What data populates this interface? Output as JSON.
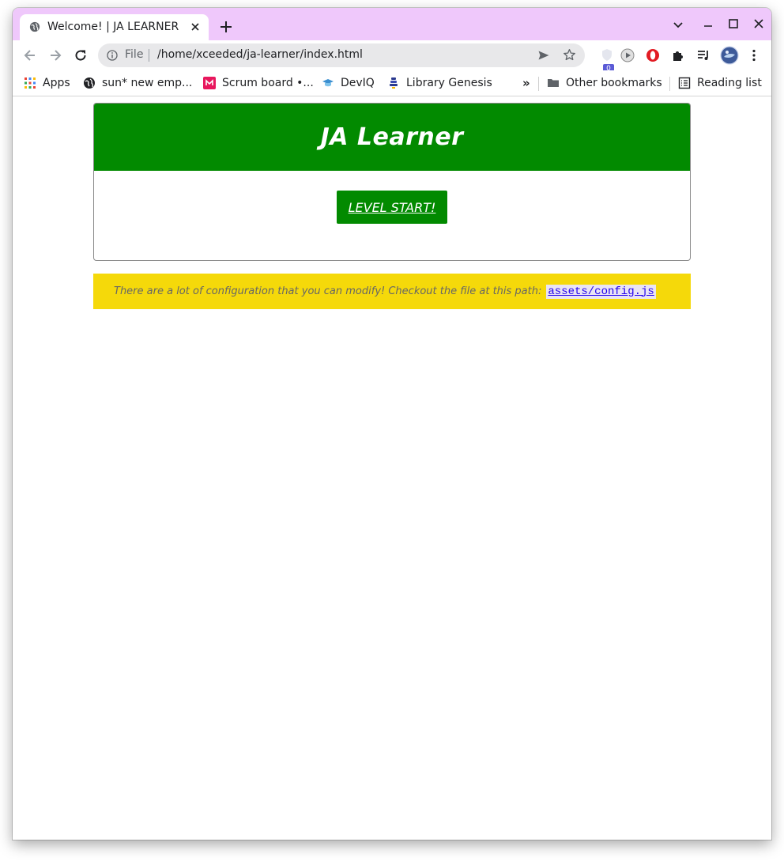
{
  "browser": {
    "tab": {
      "title": "Welcome! | JA LEARNER",
      "favicon": "globe-icon"
    },
    "omnibox": {
      "scheme": "File",
      "url": "/home/xceeded/ja-learner/index.html"
    },
    "extensions": {
      "badge_count": "0"
    },
    "bookmarks": [
      {
        "label": "Apps",
        "icon": "apps-grid-icon"
      },
      {
        "label": "sun* new emp...",
        "icon": "globe-icon"
      },
      {
        "label": "Scrum board •...",
        "icon": "m-logo-icon"
      },
      {
        "label": "DevIQ",
        "icon": "graduation-cap-icon"
      },
      {
        "label": "Library Genesis",
        "icon": "library-icon"
      }
    ],
    "overflow_label": "»",
    "other_bookmarks": "Other bookmarks",
    "reading_list": "Reading list"
  },
  "page": {
    "header": {
      "title": "JA Learner",
      "bg_color": "#028a00"
    },
    "start_button": {
      "label": "LEVEL START!"
    },
    "notice": {
      "text": "There are a lot of configuration that you can modify! Checkout the file at this path:",
      "path": "assets/config.js",
      "bg_color": "#f5d90a"
    }
  },
  "colors": {
    "tab_strip": "#efc8fb",
    "accent_green": "#028a00",
    "notice_yellow": "#f5d90a"
  }
}
